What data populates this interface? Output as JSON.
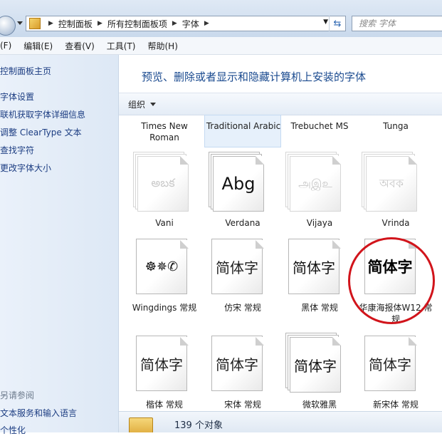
{
  "window": {
    "breadcrumbs": [
      "控制面板",
      "所有控制面板项",
      "字体"
    ],
    "search_placeholder": "搜索 字体"
  },
  "menu": [
    "(F)",
    "编辑(E)",
    "查看(V)",
    "工具(T)",
    "帮助(H)"
  ],
  "left_pane": {
    "links": [
      "控制面板主页",
      "字体设置",
      "联机获取字体详细信息",
      "调整 ClearType 文本",
      "查找字符",
      "更改字体大小"
    ],
    "see_also_heading": "另请参阅",
    "see_also_links": [
      "文本服务和输入语言",
      "个性化"
    ]
  },
  "main": {
    "title": "预览、删除或者显示和隐藏计算机上安装的字体",
    "organize_label": "组织",
    "status_text": "139 个对象"
  },
  "fonts_row0": [
    {
      "name": "Times New Roman"
    },
    {
      "name": "Traditional Arabic"
    },
    {
      "name": "Trebuchet MS"
    },
    {
      "name": "Tunga"
    }
  ],
  "fonts_row1": [
    {
      "name": "Vani",
      "sample": "అబక"
    },
    {
      "name": "Verdana",
      "sample": "Abg"
    },
    {
      "name": "Vijaya",
      "sample": "அஇஉ"
    },
    {
      "name": "Vrinda",
      "sample": "অবক"
    }
  ],
  "fonts_row2": [
    {
      "name": "Wingdings 常规",
      "sample": "☸✵✆"
    },
    {
      "name": "仿宋 常规",
      "sample": "简体字"
    },
    {
      "name": "黑体 常规",
      "sample": "简体字"
    },
    {
      "name": "华康海报体W12 常规",
      "sample": "简体字"
    }
  ],
  "fonts_row3": [
    {
      "name": "楷体 常规",
      "sample": "简体字"
    },
    {
      "name": "宋体 常规",
      "sample": "简体字"
    },
    {
      "name": "微软雅黑",
      "sample": "简体字"
    },
    {
      "name": "新宋体 常规",
      "sample": "简体字"
    }
  ],
  "highlight_color": "#d1141b"
}
